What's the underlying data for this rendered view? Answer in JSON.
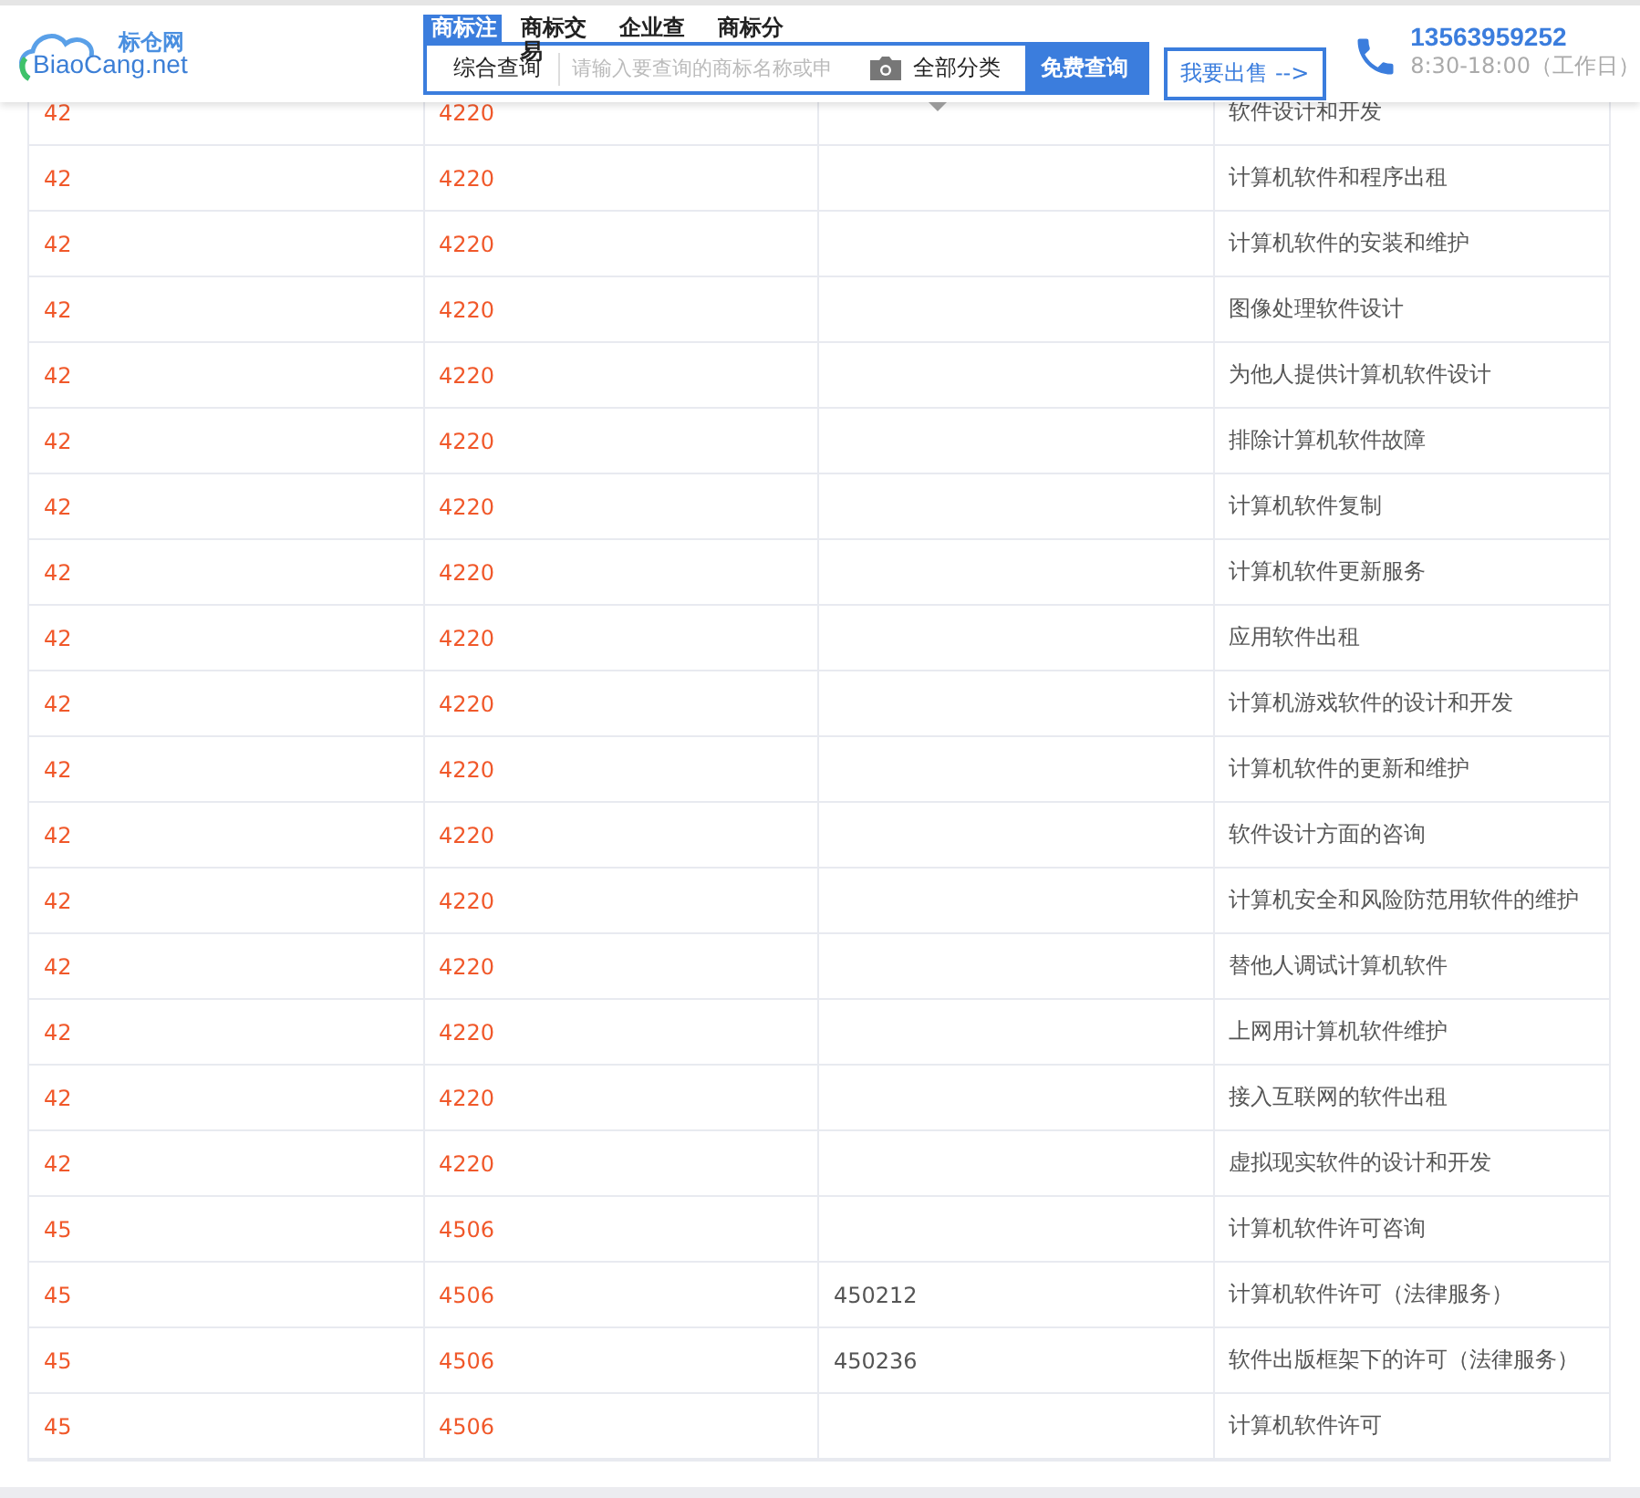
{
  "logo": {
    "name": "标仓网",
    "domain": "BiaoCang.net"
  },
  "nav_tabs": [
    {
      "label": "商标注",
      "selected": true
    },
    {
      "label": "商标交易",
      "selected": false
    },
    {
      "label": "企业查",
      "selected": false
    },
    {
      "label": "商标分",
      "selected": false
    }
  ],
  "search": {
    "scope": "综合查询",
    "placeholder": "请输入要查询的商标名称或申",
    "category": "全部分类",
    "button": "免费查询"
  },
  "sell_button": "我要出售 -->",
  "contact": {
    "phone": "13563959252",
    "hours": "8:30-18:00（工作日）"
  },
  "rows": [
    [
      "42",
      "4220",
      "",
      "软件设计和开发"
    ],
    [
      "42",
      "4220",
      "",
      "计算机软件和程序出租"
    ],
    [
      "42",
      "4220",
      "",
      "计算机软件的安装和维护"
    ],
    [
      "42",
      "4220",
      "",
      "图像处理软件设计"
    ],
    [
      "42",
      "4220",
      "",
      "为他人提供计算机软件设计"
    ],
    [
      "42",
      "4220",
      "",
      "排除计算机软件故障"
    ],
    [
      "42",
      "4220",
      "",
      "计算机软件复制"
    ],
    [
      "42",
      "4220",
      "",
      "计算机软件更新服务"
    ],
    [
      "42",
      "4220",
      "",
      "应用软件出租"
    ],
    [
      "42",
      "4220",
      "",
      "计算机游戏软件的设计和开发"
    ],
    [
      "42",
      "4220",
      "",
      "计算机软件的更新和维护"
    ],
    [
      "42",
      "4220",
      "",
      "软件设计方面的咨询"
    ],
    [
      "42",
      "4220",
      "",
      "计算机安全和风险防范用软件的维护"
    ],
    [
      "42",
      "4220",
      "",
      "替他人调试计算机软件"
    ],
    [
      "42",
      "4220",
      "",
      "上网用计算机软件维护"
    ],
    [
      "42",
      "4220",
      "",
      "接入互联网的软件出租"
    ],
    [
      "42",
      "4220",
      "",
      "虚拟现实软件的设计和开发"
    ],
    [
      "45",
      "4506",
      "",
      "计算机软件许可咨询"
    ],
    [
      "45",
      "4506",
      "450212",
      "计算机软件许可（法律服务）"
    ],
    [
      "45",
      "4506",
      "450236",
      "软件出版框架下的许可（法律服务）"
    ],
    [
      "45",
      "4506",
      "",
      "计算机软件许可"
    ]
  ]
}
